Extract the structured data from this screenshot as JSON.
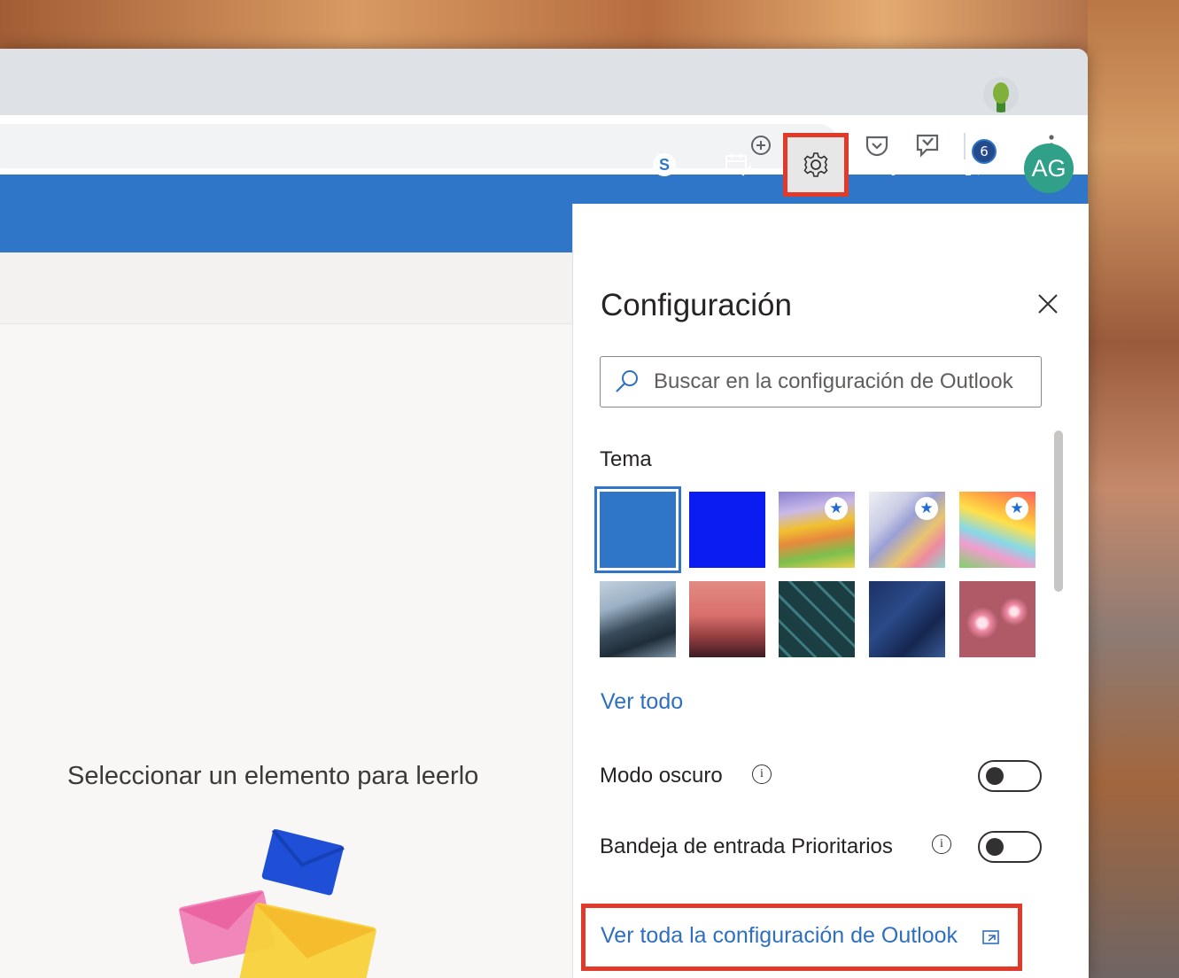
{
  "header": {
    "settings_icon": "gear-icon",
    "help_label": "?",
    "notification_count": "6",
    "avatar_initials": "AG"
  },
  "settings_panel": {
    "title": "Configuración",
    "search_placeholder": "Buscar en la configuración de Outlook",
    "theme_label": "Tema",
    "see_all_themes": "Ver todo",
    "dark_mode_label": "Modo oscuro",
    "focused_inbox_label": "Bandeja de entrada Prioritarios",
    "view_all_settings": "Ver toda la configuración de Outlook"
  },
  "reading_pane": {
    "empty_message": "Seleccionar un elemento para leerlo"
  },
  "colors": {
    "header_blue": "#2f76c8",
    "highlight_red": "#e23a2a",
    "avatar_teal": "#31a089",
    "link_blue": "#2f6fbf"
  }
}
